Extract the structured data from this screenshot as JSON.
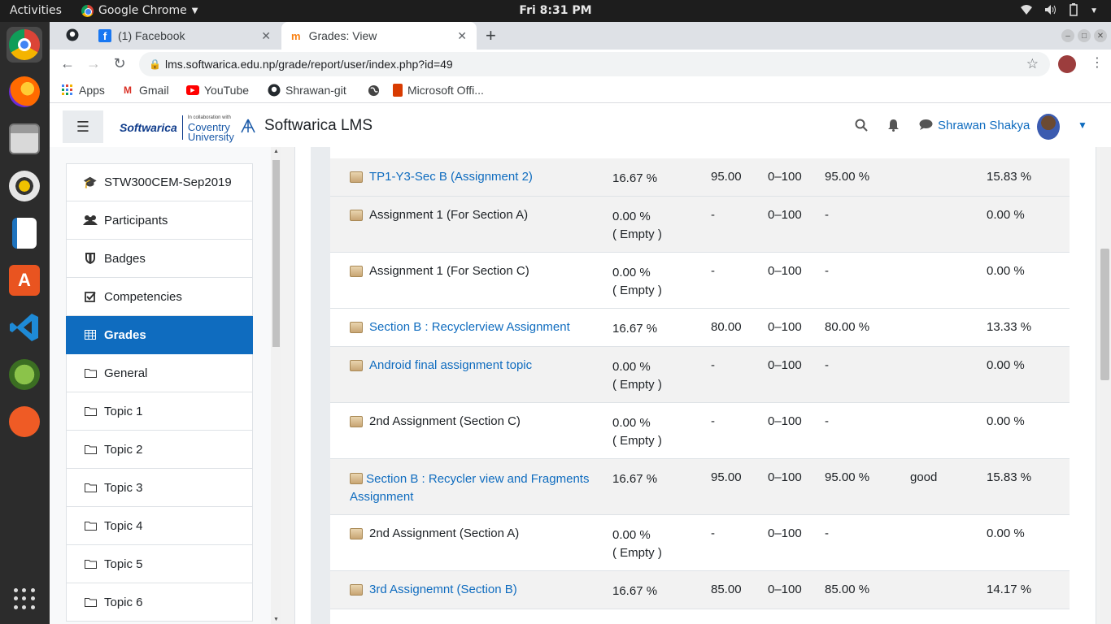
{
  "system": {
    "activities": "Activities",
    "app_menu": "Google Chrome",
    "clock": "Fri  8:31 PM"
  },
  "browser": {
    "tabs": [
      {
        "label": ""
      },
      {
        "label": "(1) Facebook"
      },
      {
        "label": "Grades: View"
      }
    ],
    "url": "lms.softwarica.edu.np/grade/report/user/index.php?id=49",
    "bookmarks": [
      {
        "label": "Apps",
        "icon": "apps-grid-icon"
      },
      {
        "label": "Gmail",
        "icon": "gmail-icon"
      },
      {
        "label": "YouTube",
        "icon": "youtube-icon"
      },
      {
        "label": "Shrawan-git",
        "icon": "github-icon"
      },
      {
        "label": "",
        "icon": "globe-icon"
      },
      {
        "label": "Microsoft Offi...",
        "icon": "office-icon"
      }
    ]
  },
  "header": {
    "logo_text": "Softwarica",
    "partner_small": "In collaboration with",
    "partner_line1": "Coventry",
    "partner_line2": "University",
    "site_name": "Softwarica LMS",
    "user_name": "Shrawan Shakya"
  },
  "nav": {
    "items": [
      {
        "label": "STW300CEM-Sep2019",
        "icon": "graduation-cap-icon"
      },
      {
        "label": "Participants",
        "icon": "users-icon"
      },
      {
        "label": "Badges",
        "icon": "shield-icon"
      },
      {
        "label": "Competencies",
        "icon": "checkbox-icon"
      },
      {
        "label": "Grades",
        "icon": "table-icon"
      },
      {
        "label": "General",
        "icon": "folder-icon"
      },
      {
        "label": "Topic 1",
        "icon": "folder-icon"
      },
      {
        "label": "Topic 2",
        "icon": "folder-icon"
      },
      {
        "label": "Topic 3",
        "icon": "folder-icon"
      },
      {
        "label": "Topic 4",
        "icon": "folder-icon"
      },
      {
        "label": "Topic 5",
        "icon": "folder-icon"
      },
      {
        "label": "Topic 6",
        "icon": "folder-icon"
      }
    ]
  },
  "grades": {
    "rows": [
      {
        "item": "TP1-Y3-Sec B (Assignment 2)",
        "weight": "16.67 %",
        "empty": "",
        "grade": "95.00",
        "range": "0–100",
        "pct": "95.00 %",
        "feedback": "",
        "contrib": "15.83 %"
      },
      {
        "item": "Assignment 1 (For Section A)",
        "weight": "0.00 %",
        "empty": "( Empty )",
        "grade": "-",
        "range": "0–100",
        "pct": "-",
        "feedback": "",
        "contrib": "0.00 %"
      },
      {
        "item": "Assignment 1 (For Section C)",
        "weight": "0.00 %",
        "empty": "( Empty )",
        "grade": "-",
        "range": "0–100",
        "pct": "-",
        "feedback": "",
        "contrib": "0.00 %"
      },
      {
        "item": "Section B : Recyclerview Assignment",
        "weight": "16.67 %",
        "empty": "",
        "grade": "80.00",
        "range": "0–100",
        "pct": "80.00 %",
        "feedback": "",
        "contrib": "13.33 %"
      },
      {
        "item": "Android final assignment topic",
        "weight": "0.00 %",
        "empty": "( Empty )",
        "grade": "-",
        "range": "0–100",
        "pct": "-",
        "feedback": "",
        "contrib": "0.00 %"
      },
      {
        "item": "2nd Assignment (Section C)",
        "weight": "0.00 %",
        "empty": "( Empty )",
        "grade": "-",
        "range": "0–100",
        "pct": "-",
        "feedback": "",
        "contrib": "0.00 %"
      },
      {
        "item": "Section B : Recycler view and Fragments Assignment",
        "weight": "16.67 %",
        "empty": "",
        "grade": "95.00",
        "range": "0–100",
        "pct": "95.00 %",
        "feedback": "good",
        "contrib": "15.83 %"
      },
      {
        "item": "2nd Assignment (Section A)",
        "weight": "0.00 %",
        "empty": "( Empty )",
        "grade": "-",
        "range": "0–100",
        "pct": "-",
        "feedback": "",
        "contrib": "0.00 %"
      },
      {
        "item": "3rd Assignemnt (Section B)",
        "weight": "16.67 %",
        "empty": "",
        "grade": "85.00",
        "range": "0–100",
        "pct": "85.00 %",
        "feedback": "",
        "contrib": "14.17 %"
      }
    ]
  },
  "colors": {
    "accent": "#0f6cbf",
    "link": "#0f6cbf"
  }
}
